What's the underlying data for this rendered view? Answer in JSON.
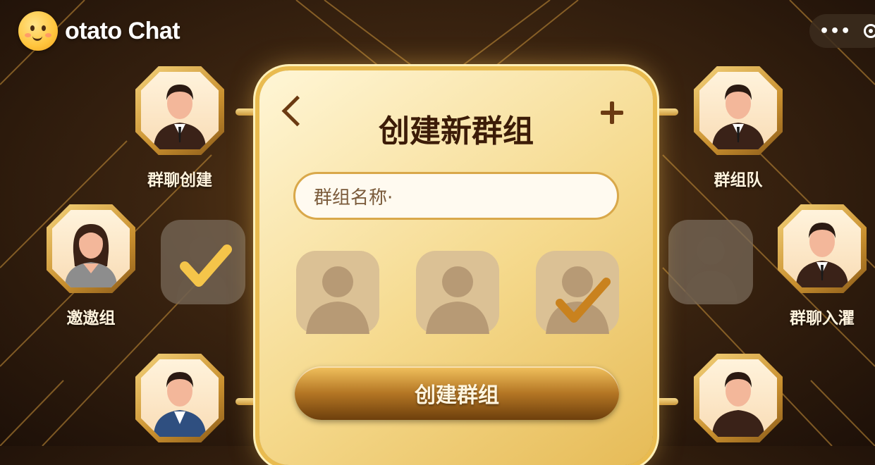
{
  "app": {
    "brand": "otato Chat"
  },
  "header": {
    "more_icon": "more-dots-icon",
    "close_icon": "target-icon"
  },
  "panel": {
    "title": "创建新群组",
    "back_icon": "chevron-left-icon",
    "add_icon": "plus-icon",
    "input_placeholder": "群组名称·",
    "members": [
      {
        "icon": "person-silhouette-icon",
        "selected": false
      },
      {
        "icon": "person-silhouette-icon",
        "selected": false
      },
      {
        "icon": "person-silhouette-icon",
        "selected": true
      }
    ],
    "create_label": "创建群组"
  },
  "tiles": {
    "top_left": "群聊创建",
    "mid_left": "邀遨组",
    "top_right": "群组队",
    "mid_right": "群聊入灈",
    "bottom_left": "",
    "bottom_right": ""
  },
  "colors": {
    "gold": "#e9bb4f",
    "dark_brown": "#3c1c08",
    "background": "#3b2410"
  }
}
